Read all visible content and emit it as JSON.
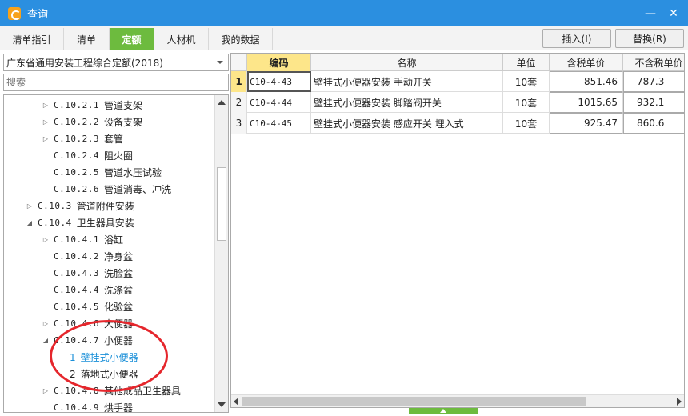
{
  "window": {
    "title": "查询",
    "min_glyph": "—",
    "close_glyph": "✕"
  },
  "tabs": [
    {
      "label": "清单指引"
    },
    {
      "label": "清单"
    },
    {
      "label": "定额",
      "active": true
    },
    {
      "label": "人材机"
    },
    {
      "label": "我的数据"
    }
  ],
  "actions": {
    "insert": "插入(I)",
    "replace": "替换(R)"
  },
  "left": {
    "quota_select": "广东省通用安装工程综合定额(2018)",
    "search_placeholder": "搜索",
    "tree": [
      {
        "caret": "▷",
        "code": "C.10.2.1",
        "label": "管道支架"
      },
      {
        "caret": "▷",
        "code": "C.10.2.2",
        "label": "设备支架"
      },
      {
        "caret": "▷",
        "code": "C.10.2.3",
        "label": "套管"
      },
      {
        "caret": "",
        "code": "C.10.2.4",
        "label": "阻火圈"
      },
      {
        "caret": "",
        "code": "C.10.2.5",
        "label": "管道水压试验"
      },
      {
        "caret": "",
        "code": "C.10.2.6",
        "label": "管道消毒、冲洗"
      },
      {
        "caret": "▷",
        "code": "C.10.3",
        "label": "管道附件安装"
      },
      {
        "caret": "◢",
        "code": "C.10.4",
        "label": "卫生器具安装"
      },
      {
        "caret": "▷",
        "code": "C.10.4.1",
        "label": "浴缸"
      },
      {
        "caret": "",
        "code": "C.10.4.2",
        "label": "净身盆"
      },
      {
        "caret": "",
        "code": "C.10.4.3",
        "label": "洗脸盆"
      },
      {
        "caret": "",
        "code": "C.10.4.4",
        "label": "洗涤盆"
      },
      {
        "caret": "",
        "code": "C.10.4.5",
        "label": "化验盆"
      },
      {
        "caret": "▷",
        "code": "C.10.4.6",
        "label": "大便器"
      },
      {
        "caret": "◢",
        "code": "C.10.4.7",
        "label": "小便器"
      },
      {
        "caret": "",
        "num": "1",
        "label": "壁挂式小便器",
        "selected": true
      },
      {
        "caret": "",
        "num": "2",
        "label": "落地式小便器"
      },
      {
        "caret": "▷",
        "code": "C.10.4.8",
        "label": "其他成品卫生器具"
      },
      {
        "caret": "",
        "code": "C.10.4.9",
        "label": "烘手器"
      }
    ]
  },
  "grid": {
    "columns": [
      "",
      "编码",
      "名称",
      "单位",
      "含税单价",
      "不含税单价"
    ],
    "rows": [
      {
        "n": "1",
        "code": "C10-4-43",
        "name": "壁挂式小便器安装 手动开关",
        "unit": "10套",
        "tax_price": "851.46",
        "notax_price": "787.3"
      },
      {
        "n": "2",
        "code": "C10-4-44",
        "name": "壁挂式小便器安装 脚踏阀开关",
        "unit": "10套",
        "tax_price": "1015.65",
        "notax_price": "932.1"
      },
      {
        "n": "3",
        "code": "C10-4-45",
        "name": "壁挂式小便器安装 感应开关 埋入式",
        "unit": "10套",
        "tax_price": "925.47",
        "notax_price": "860.6"
      }
    ]
  },
  "colors": {
    "titlebar": "#2b8fe0",
    "active_tab": "#6dbb3e",
    "header_highlight": "#fde68a",
    "selected_text": "#1a8fd8",
    "annotation": "#e5262c"
  }
}
